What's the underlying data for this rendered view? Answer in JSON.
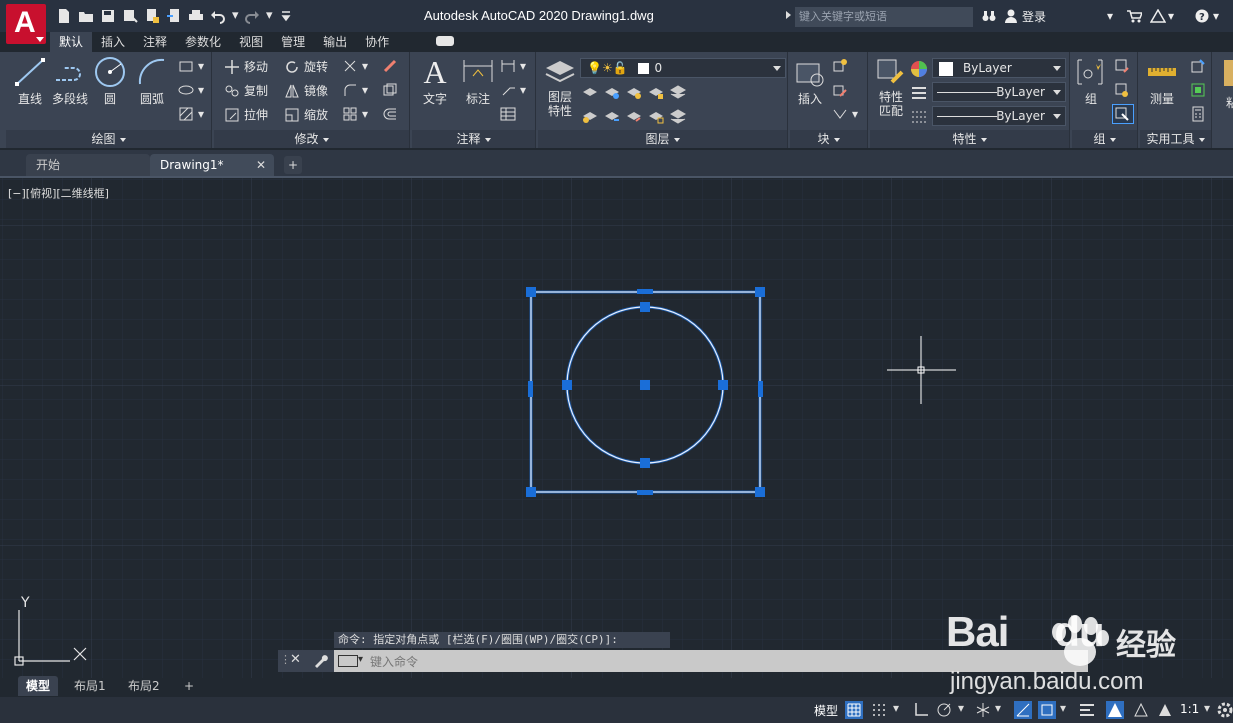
{
  "app": {
    "title": "Autodesk AutoCAD 2020    Drawing1.dwg",
    "logo_letter": "A"
  },
  "search": {
    "placeholder": "键入关键字或短语"
  },
  "user": {
    "label": "登录"
  },
  "ribbon_tabs": [
    "默认",
    "插入",
    "注释",
    "参数化",
    "视图",
    "管理",
    "输出",
    "协作"
  ],
  "panels": {
    "draw": {
      "title": "绘图",
      "line": "直线",
      "polyline": "多段线",
      "circle": "圆",
      "arc": "圆弧"
    },
    "modify": {
      "title": "修改",
      "move": "移动",
      "rotate": "旋转",
      "copy": "复制",
      "mirror": "镜像",
      "stretch": "拉伸",
      "scale": "缩放"
    },
    "annotation": {
      "title": "注释",
      "text": "文字",
      "dimension": "标注"
    },
    "layers": {
      "title": "图层",
      "layer_props": "图层\n特性",
      "current_layer": "0"
    },
    "block": {
      "title": "块",
      "insert": "插入"
    },
    "properties": {
      "title": "特性",
      "match": "特性\n匹配",
      "color": "ByLayer",
      "linetype": "ByLayer",
      "lineweight": "ByLayer"
    },
    "groups": {
      "title": "组",
      "group": "组"
    },
    "utilities": {
      "title": "实用工具",
      "measure": "测量"
    },
    "extra": {
      "label": "粘"
    }
  },
  "file_tabs": {
    "start": "开始",
    "drawing": "Drawing1*"
  },
  "viewport": {
    "label": "[−][俯视][二维线框]"
  },
  "ucs": {
    "x": "X",
    "y": "Y"
  },
  "command": {
    "history": "命令: 指定对角点或 [栏选(F)/圈围(WP)/圈交(CP)]:",
    "placeholder": "键入命令"
  },
  "layout_tabs": [
    "模型",
    "布局1",
    "布局2"
  ],
  "status": {
    "model": "模型",
    "scale": "1:1"
  },
  "watermark": {
    "brand": "Bai",
    "brand2": "du",
    "cn": "经验",
    "url": "jingyan.baidu.com"
  },
  "colors": {
    "accent": "#c8102e",
    "selection": "#1a6ed8",
    "geometry": "#e8f0ff",
    "canvas": "#212830"
  }
}
